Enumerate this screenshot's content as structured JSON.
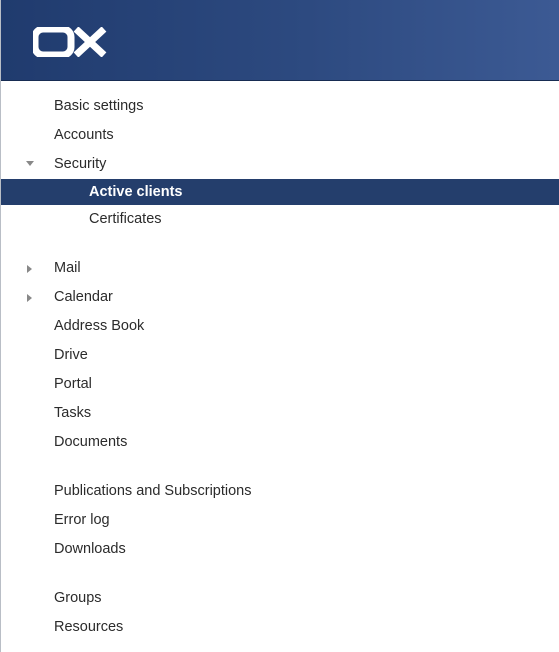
{
  "header": {
    "logo_text": "OX"
  },
  "nav": {
    "basic_settings": "Basic settings",
    "accounts": "Accounts",
    "security": "Security",
    "active_clients": "Active clients",
    "certificates": "Certificates",
    "mail": "Mail",
    "calendar": "Calendar",
    "address_book": "Address Book",
    "drive": "Drive",
    "portal": "Portal",
    "tasks": "Tasks",
    "documents": "Documents",
    "publications": "Publications and Subscriptions",
    "error_log": "Error log",
    "downloads": "Downloads",
    "groups": "Groups",
    "resources": "Resources"
  },
  "colors": {
    "header_bar": "#2d4a80",
    "selected_item": "#243e6c",
    "text": "#2b2b2b"
  },
  "icons": {
    "expanded": "caret-down-icon",
    "collapsed": "caret-right-icon"
  }
}
